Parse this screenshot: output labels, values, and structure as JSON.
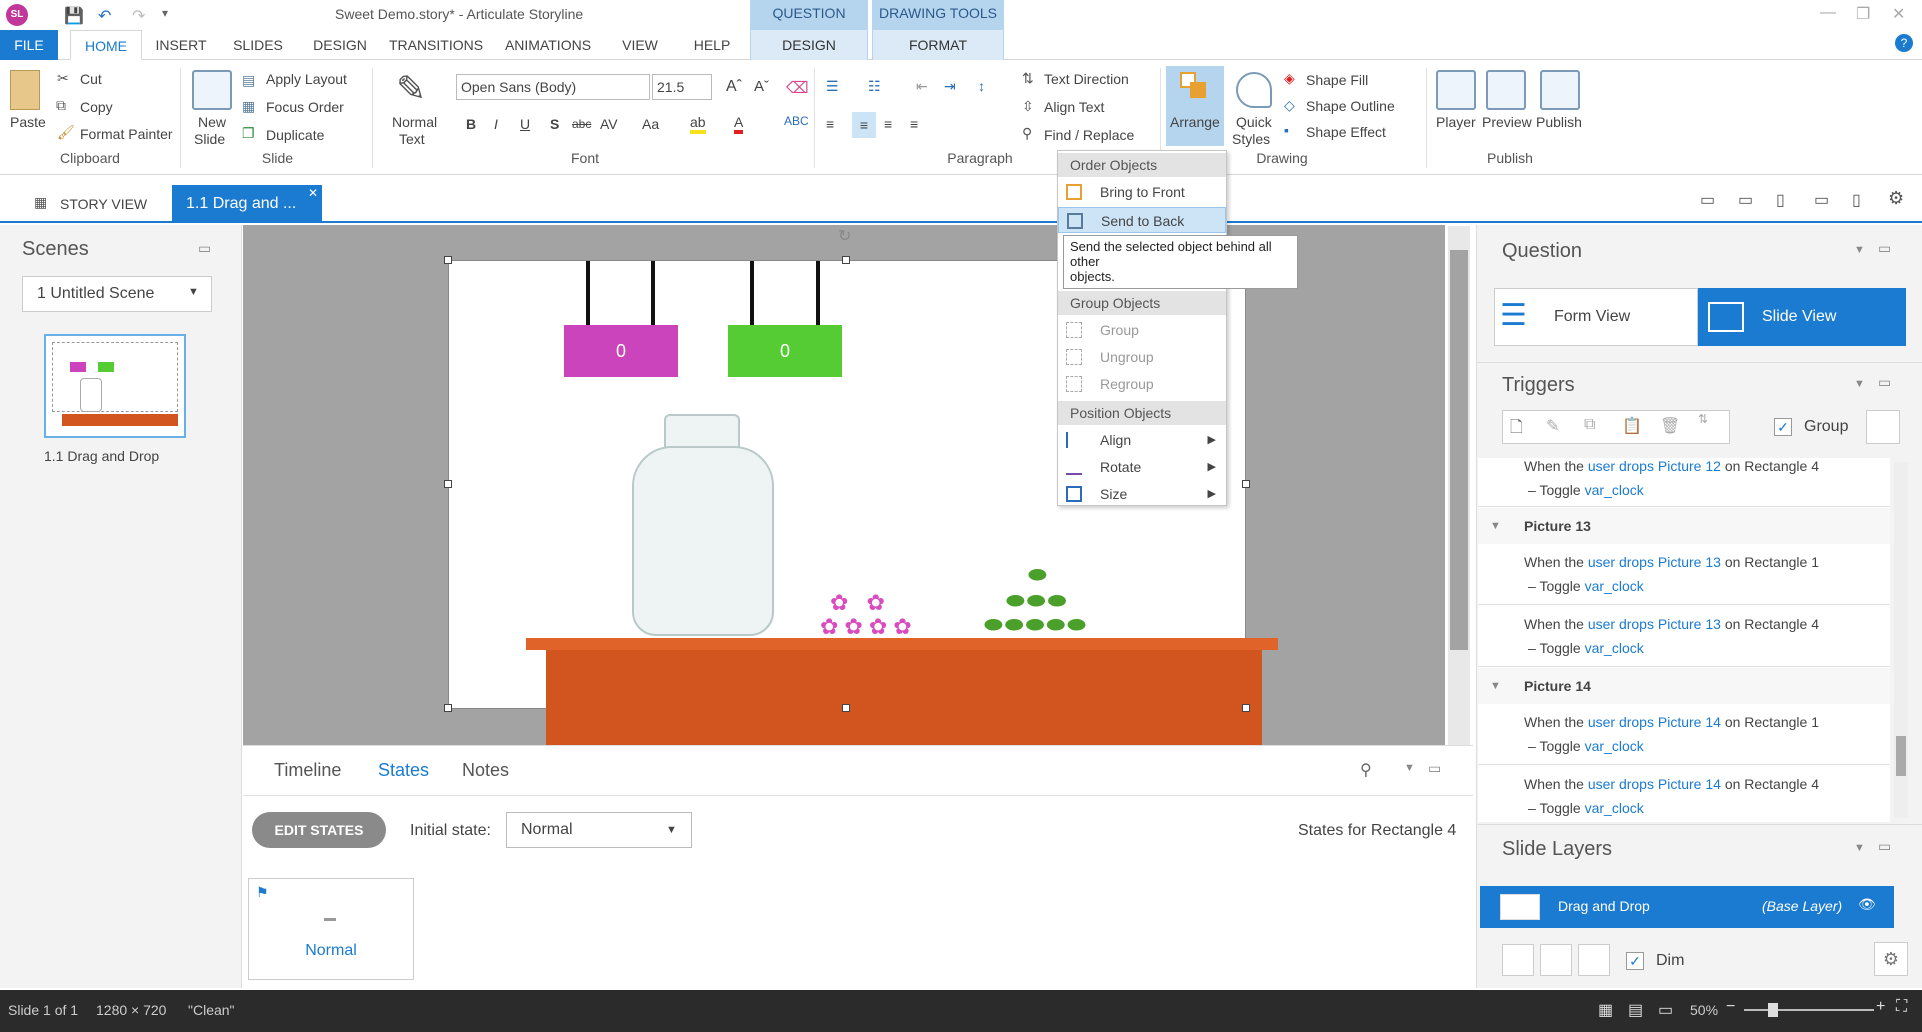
{
  "app": {
    "logo": "SL",
    "title": "Sweet Demo.story* - Articulate Storyline",
    "context_tabs": {
      "question_tools": "QUESTION TOOLS",
      "drawing_tools": "DRAWING TOOLS",
      "design": "DESIGN",
      "format": "FORMAT"
    }
  },
  "tabs": [
    "FILE",
    "HOME",
    "INSERT",
    "SLIDES",
    "DESIGN",
    "TRANSITIONS",
    "ANIMATIONS",
    "VIEW",
    "HELP"
  ],
  "ribbon": {
    "clipboard": {
      "paste": "Paste",
      "cut": "Cut",
      "copy": "Copy",
      "format_painter": "Format Painter",
      "group": "Clipboard"
    },
    "slide": {
      "new_slide_line1": "New",
      "new_slide_line2": "Slide",
      "apply_layout": "Apply Layout",
      "focus_order": "Focus Order",
      "duplicate": "Duplicate",
      "group": "Slide"
    },
    "normal_text_line1": "Normal",
    "normal_text_line2": "Text",
    "font": {
      "family": "Open Sans (Body)",
      "size": "21.5",
      "group": "Font",
      "aa": "Aa"
    },
    "paragraph": {
      "text_direction": "Text Direction",
      "align_text": "Align Text",
      "find_replace": "Find / Replace",
      "group": "Paragraph"
    },
    "arrange": "Arrange",
    "quick_styles_line1": "Quick",
    "quick_styles_line2": "Styles",
    "drawing": {
      "shape_fill": "Shape Fill",
      "shape_outline": "Shape Outline",
      "shape_effect": "Shape Effect",
      "group": "Drawing"
    },
    "publish": {
      "player": "Player",
      "preview": "Preview",
      "publish": "Publish",
      "group": "Publish"
    }
  },
  "doc_tabs": {
    "story_view": "STORY VIEW",
    "slide_tab": "1.1 Drag and ..."
  },
  "scenes": {
    "title": "Scenes",
    "selected": "1 Untitled Scene",
    "thumb_label": "1.1 Drag and Drop"
  },
  "slide": {
    "counter_left": "0",
    "counter_right": "0",
    "colors": {
      "magenta": "#cc44bb",
      "green": "#55cc33",
      "shelf": "#d2541e"
    }
  },
  "context_menu": {
    "order_objects": "Order Objects",
    "bring_to_front": "Bring to Front",
    "send_to_back": "Send to Back",
    "group_objects": "Group Objects",
    "group": "Group",
    "ungroup": "Ungroup",
    "regroup": "Regroup",
    "position_objects": "Position Objects",
    "align": "Align",
    "rotate": "Rotate",
    "size": "Size"
  },
  "tooltip": {
    "line1": "Send the selected object behind all",
    "line2": "other",
    "line3": "objects."
  },
  "bottom": {
    "tabs": [
      "Timeline",
      "States",
      "Notes"
    ],
    "edit_states": "EDIT STATES",
    "initial_state_label": "Initial state:",
    "initial_state_value": "Normal",
    "states_for": "States for Rectangle 4",
    "state_card": "Normal"
  },
  "question": {
    "title": "Question",
    "form_view": "Form View",
    "slide_view": "Slide View"
  },
  "triggers": {
    "title": "Triggers",
    "group_label": "Group",
    "items": [
      {
        "when": "When the",
        "user": "user drops",
        "picture": "Picture 12",
        "on": "on Rectangle 4",
        "toggle": "Toggle",
        "var": "var_clock"
      },
      {
        "header": "Picture 13"
      },
      {
        "when": "When the",
        "user": "user drops",
        "picture": "Picture 13",
        "on": "on Rectangle 1",
        "toggle": "Toggle",
        "var": "var_clock"
      },
      {
        "when": "When the",
        "user": "user drops",
        "picture": "Picture 13",
        "on": "on Rectangle 4",
        "toggle": "Toggle",
        "var": "var_clock"
      },
      {
        "header": "Picture 14"
      },
      {
        "when": "When the",
        "user": "user drops",
        "picture": "Picture 14",
        "on": "on Rectangle 1",
        "toggle": "Toggle",
        "var": "var_clock"
      },
      {
        "when": "When the",
        "user": "user drops",
        "picture": "Picture 14",
        "on": "on Rectangle 4",
        "toggle": "Toggle",
        "var": "var_clock"
      }
    ]
  },
  "layers": {
    "title": "Slide Layers",
    "base_name": "Drag and Drop",
    "base_tag": "(Base Layer)",
    "dim": "Dim"
  },
  "status": {
    "slide": "Slide 1 of 1",
    "dims": "1280 × 720",
    "theme": "\"Clean\"",
    "zoom": "50%"
  },
  "accent": "#1a7bd0"
}
